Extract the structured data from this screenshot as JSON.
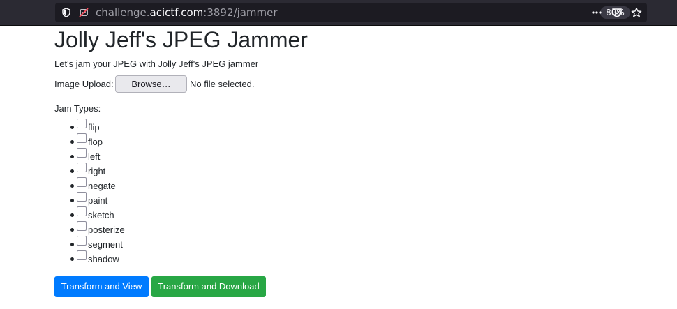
{
  "browser": {
    "url_prefix": "challenge.",
    "url_domain": "acictf.com",
    "url_suffix": ":3892/jammer",
    "zoom_level": "80%",
    "icons": [
      "shield-icon",
      "blocked-permission-icon",
      "more-options-icon",
      "pocket-icon",
      "bookmark-star-icon"
    ]
  },
  "page": {
    "title": "Jolly Jeff's JPEG Jammer",
    "intro": "Let's jam your JPEG with Jolly Jeff's JPEG jammer",
    "upload": {
      "label": "Image Upload:",
      "browse_label": "Browse…",
      "file_status": "No file selected."
    },
    "jam_types_label": "Jam Types:",
    "jam_types": [
      "flip",
      "flop",
      "left",
      "right",
      "negate",
      "paint",
      "sketch",
      "posterize",
      "segment",
      "shadow"
    ],
    "buttons": {
      "view_label": "Transform and View",
      "download_label": "Transform and Download"
    }
  },
  "colors": {
    "primary": "#007bff",
    "success": "#28a745",
    "chrome_bg": "#2b2a33",
    "url_bar_bg": "#1c1b22"
  }
}
